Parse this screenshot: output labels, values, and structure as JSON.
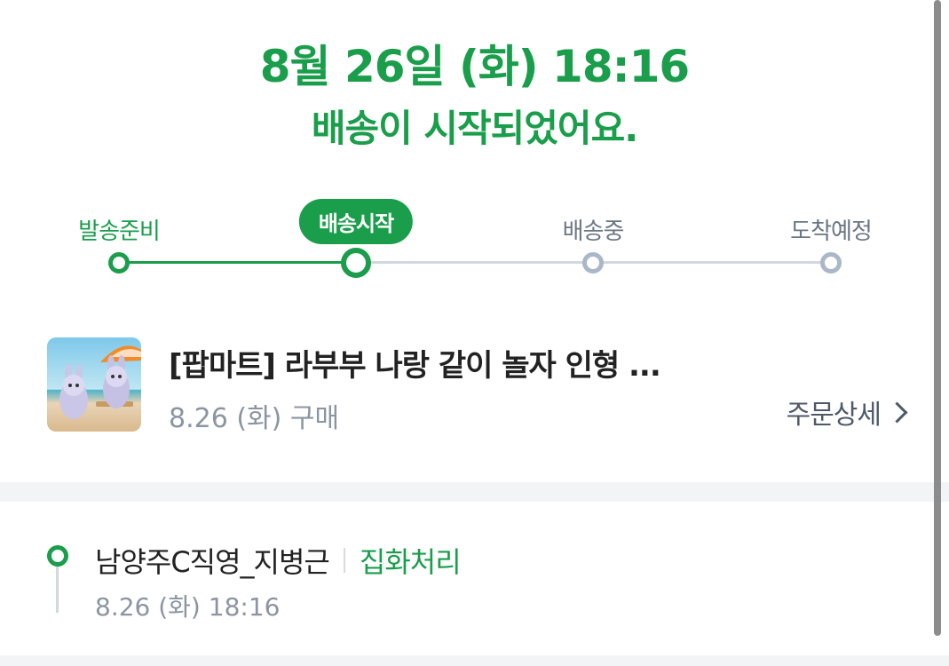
{
  "header": {
    "date_time": "8월 26일 (화) 18:16",
    "message": "배송이 시작되었어요."
  },
  "progress": {
    "steps": [
      {
        "label": "발송준비",
        "state": "done"
      },
      {
        "label": "배송시작",
        "state": "current"
      },
      {
        "label": "배송중",
        "state": "todo"
      },
      {
        "label": "도착예정",
        "state": "todo"
      }
    ]
  },
  "product": {
    "title": "[팝마트] 라부부 나랑 같이 놀자 인형 ...",
    "purchase_date": "8.26 (화) 구매",
    "detail_link": "주문상세"
  },
  "tracking": {
    "location": "남양주C직영_지병근",
    "status": "집화처리",
    "time": "8.26 (화) 18:16"
  },
  "colors": {
    "accent": "#1a9e4b",
    "inactive": "#a9b7c9",
    "divider": "#f2f4f6"
  },
  "icons": {
    "detail": "chevron-right-icon"
  }
}
